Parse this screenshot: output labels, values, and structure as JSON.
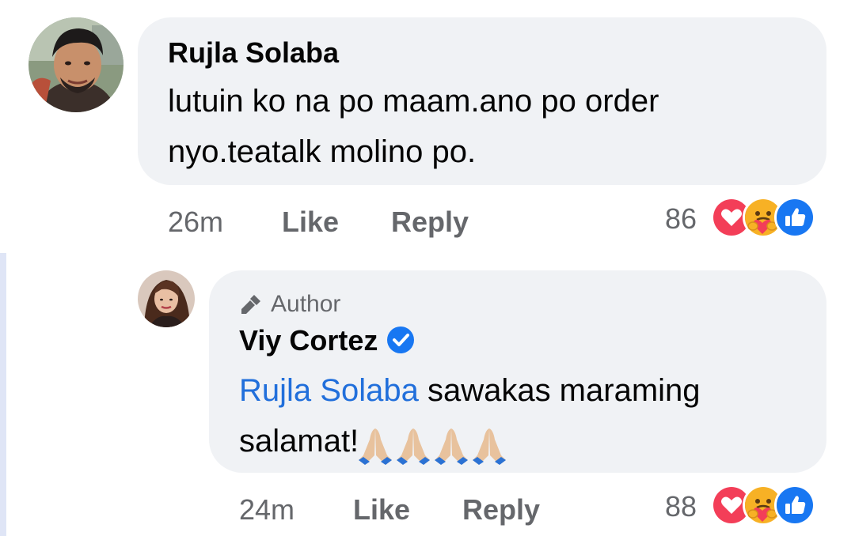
{
  "comment": {
    "author": "Rujla Solaba",
    "text": "lutuin ko na po maam.ano po order nyo.teatalk molino po.",
    "time": "26m",
    "like_label": "Like",
    "reply_label": "Reply",
    "reaction_count": "86",
    "reactions": [
      "love-icon",
      "care-icon",
      "like-icon"
    ]
  },
  "reply": {
    "badge": "Author",
    "author": "Viy Cortez",
    "verified": true,
    "mention": "Rujla Solaba",
    "text": " sawakas maraming salamat!",
    "emojis": [
      "folded-hands-icon",
      "folded-hands-icon",
      "folded-hands-icon",
      "folded-hands-icon"
    ],
    "time": "24m",
    "like_label": "Like",
    "reply_label": "Reply",
    "reaction_count": "88",
    "reactions": [
      "love-icon",
      "care-icon",
      "like-icon"
    ]
  },
  "colors": {
    "bubble": "#f0f2f5",
    "mention": "#216fdb",
    "meta": "#65676b",
    "love": "#f33e58",
    "like": "#1877f2",
    "care": "#f7b125",
    "thread_line": "#dfe5f6"
  }
}
